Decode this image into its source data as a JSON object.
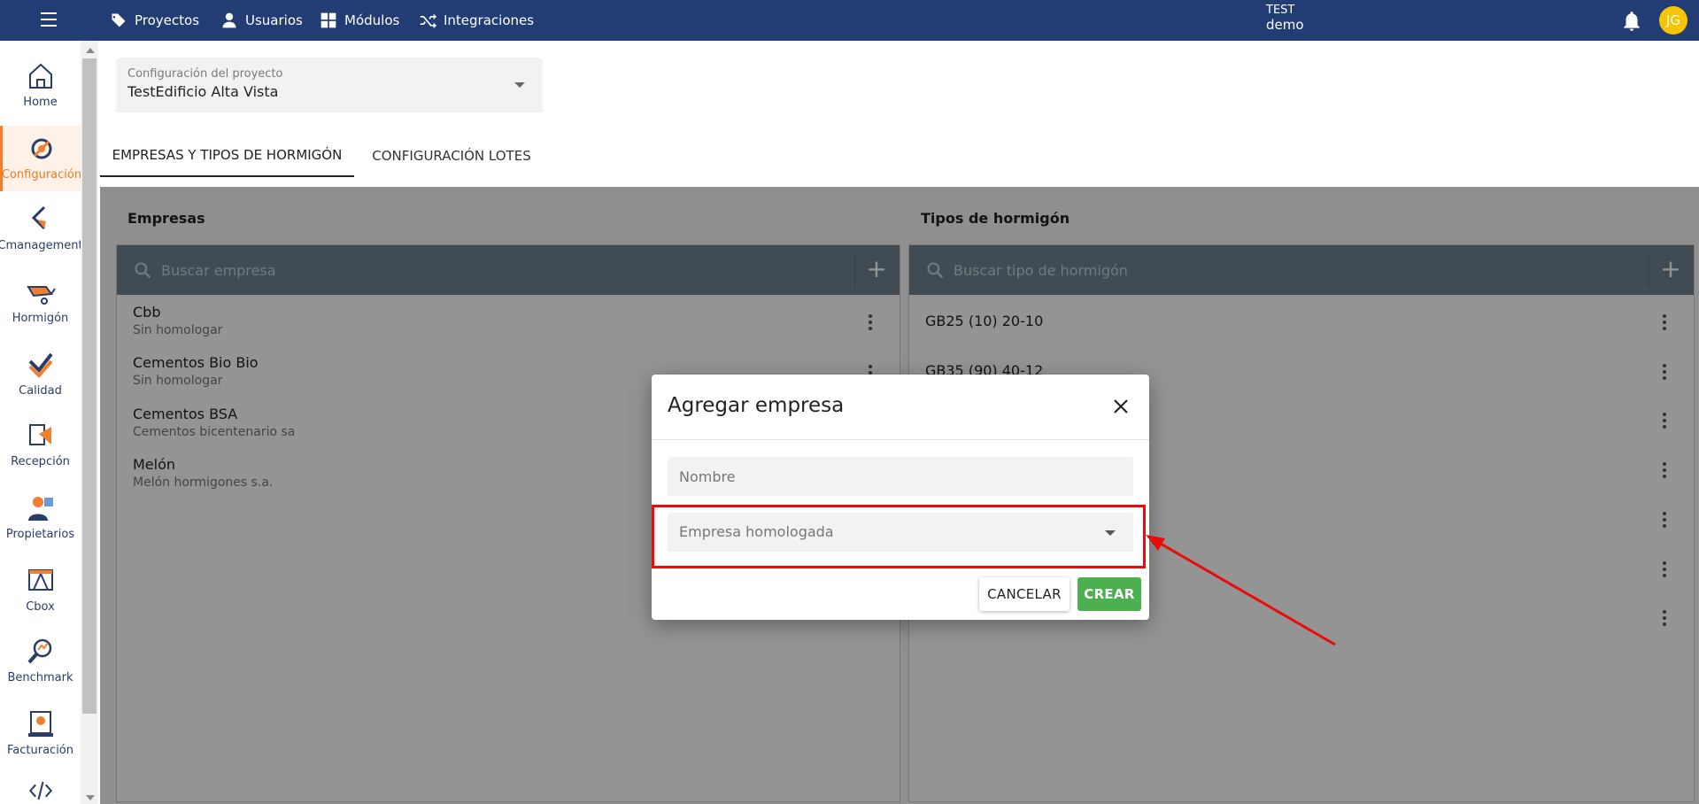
{
  "topbar": {
    "nav": [
      {
        "label": "Proyectos",
        "icon": "tags-icon"
      },
      {
        "label": "Usuarios",
        "icon": "user-icon"
      },
      {
        "label": "Módulos",
        "icon": "grid-icon"
      },
      {
        "label": "Integraciones",
        "icon": "shuffle-icon"
      }
    ],
    "env_line1": "TEST",
    "env_line2": "demo",
    "avatar_initials": "JG",
    "avatar_color": "#f6c400"
  },
  "sidebar": {
    "items": [
      {
        "label": "Home"
      },
      {
        "label": "Configuración"
      },
      {
        "label": "Cmanagement"
      },
      {
        "label": "Hormigón"
      },
      {
        "label": "Calidad"
      },
      {
        "label": "Recepción"
      },
      {
        "label": "Propietarios"
      },
      {
        "label": "Cbox"
      },
      {
        "label": "Benchmark"
      },
      {
        "label": "Facturación"
      }
    ],
    "active_color": "#f07a1e"
  },
  "project_select": {
    "label": "Configuración del proyecto",
    "value": "TestEdificio Alta Vista"
  },
  "tabs": [
    {
      "label": "EMPRESAS Y TIPOS DE HORMIGÓN",
      "active": true
    },
    {
      "label": "CONFIGURACIÓN LOTES",
      "active": false
    }
  ],
  "empresas": {
    "title": "Empresas",
    "search_placeholder": "Buscar empresa",
    "items": [
      {
        "name": "Cbb",
        "subtitle": "Sin homologar"
      },
      {
        "name": "Cementos Bio Bio",
        "subtitle": "Sin homologar"
      },
      {
        "name": "Cementos BSA",
        "subtitle": "Cementos bicentenario sa"
      },
      {
        "name": "Melón",
        "subtitle": "Melón hormigones s.a."
      }
    ]
  },
  "tipos": {
    "title": "Tipos de hormigón",
    "search_placeholder": "Buscar tipo de hormigón",
    "items": [
      {
        "name": "GB25 (10) 20-10"
      },
      {
        "name": "GB35 (90) 40-12"
      },
      {
        "name": ""
      },
      {
        "name": ""
      },
      {
        "name": ""
      },
      {
        "name": ""
      },
      {
        "name": ""
      }
    ]
  },
  "dialog": {
    "title": "Agregar empresa",
    "name_placeholder": "Nombre",
    "select_placeholder": "Empresa homologada",
    "cancel_label": "CANCELAR",
    "create_label": "CREAR",
    "create_color": "#4caf50",
    "highlight_color": "#ea0b0b"
  }
}
